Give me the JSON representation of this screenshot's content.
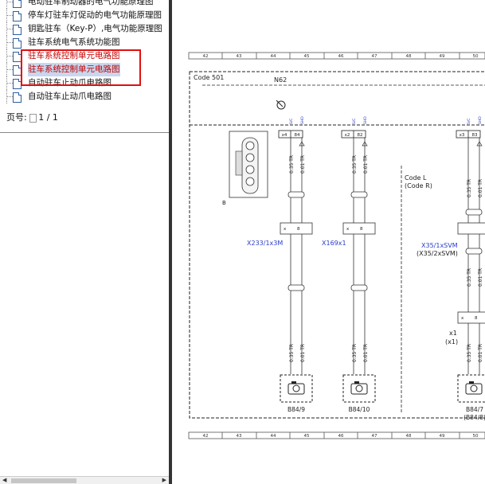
{
  "tree": {
    "items": [
      {
        "label": "电动驻车制动器的电气功能原理图",
        "style": "normal"
      },
      {
        "label": "停车灯驻车灯促动的电气功能原理图",
        "style": "normal"
      },
      {
        "label": "钥匙驻车（Key-P）,电气功能原理图",
        "style": "normal"
      },
      {
        "label": "驻车系统电气系统功能图",
        "style": "normal"
      },
      {
        "label": "驻车系统控制单元电路图",
        "style": "red"
      },
      {
        "label": "驻车系统控制单元电路图",
        "style": "selected"
      },
      {
        "label": "自动驻车止动爪电路图",
        "style": "normal"
      },
      {
        "label": "自动驻车止动爪电路图",
        "style": "normal"
      }
    ]
  },
  "page_indicator": {
    "label": "页号:",
    "value": "1 / 1"
  },
  "diagram": {
    "grid_numbers": [
      "42",
      "43",
      "44",
      "45",
      "46",
      "47",
      "48",
      "49",
      "50"
    ],
    "code_label": "Code 501",
    "module_label": "N62",
    "code_l": "Code L",
    "code_r": "(Code R)",
    "connector_b": "B",
    "pins": [
      {
        "x": "x4",
        "n": "84"
      },
      {
        "x": "x2",
        "n": "82"
      },
      {
        "x": "x3",
        "n": "83"
      }
    ],
    "pin_tags": [
      "S/C",
      "SHD"
    ],
    "wire_labels": [
      "0.35 TR",
      "0.01 TR"
    ],
    "connectors": [
      "X233/1x3M",
      "X169x1",
      "X35/1xSVM",
      "(X35/2xSVM)"
    ],
    "x1_labels": [
      "x1",
      "(x1)"
    ],
    "cameras": [
      "B84/9",
      "B84/10",
      "B84/7",
      "(B84/8)"
    ],
    "plug_text": "x",
    "plug_num": "8"
  },
  "colors": {
    "wire_label_blue": "#2a3cc8",
    "highlight_red": "#e01010",
    "selection_bg": "#c8d7ee"
  }
}
